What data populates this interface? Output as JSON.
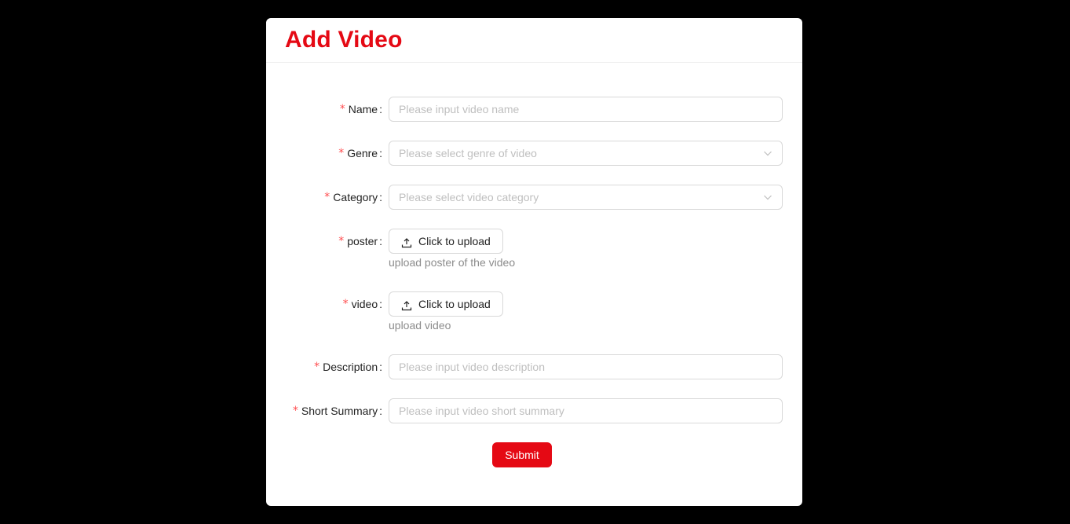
{
  "title": "Add Video",
  "fields": {
    "name": {
      "label": "Name",
      "placeholder": "Please input video name"
    },
    "genre": {
      "label": "Genre",
      "placeholder": "Please select genre of video"
    },
    "category": {
      "label": "Category",
      "placeholder": "Please select video category"
    },
    "poster": {
      "label": "poster",
      "button": "Click to upload",
      "hint": "upload poster of the video"
    },
    "video": {
      "label": "video",
      "button": "Click to upload",
      "hint": "upload video"
    },
    "description": {
      "label": "Description",
      "placeholder": "Please input video description"
    },
    "summary": {
      "label": "Short Summary",
      "placeholder": "Please input video short summary"
    }
  },
  "required_mark": "*",
  "colon": ":",
  "submit_label": "Submit",
  "colors": {
    "accent": "#e50914",
    "required": "#ff4d4f",
    "background": "#000000"
  },
  "icons": {
    "select_arrow": "chevron-down-icon",
    "upload": "upload-icon"
  }
}
